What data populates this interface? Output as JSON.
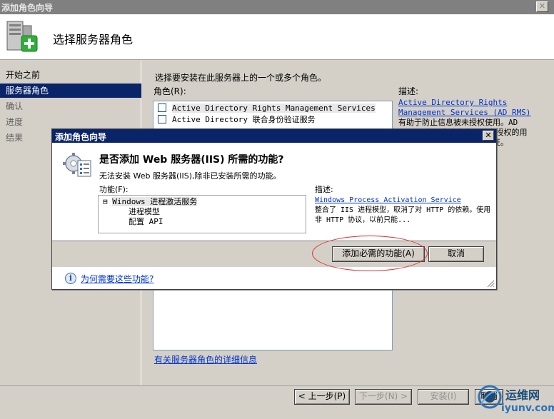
{
  "window": {
    "title": "添加角色向导",
    "close_glyph": "✕"
  },
  "header": {
    "title": "选择服务器角色"
  },
  "nav": {
    "items": [
      {
        "label": "开始之前"
      },
      {
        "label": "服务器角色"
      },
      {
        "label": "确认"
      },
      {
        "label": "进度"
      },
      {
        "label": "结果"
      }
    ]
  },
  "main": {
    "instruction": "选择要安装在此服务器上的一个或多个角色。",
    "roles_label": "角色(R):",
    "roles": [
      {
        "label": "Active Directory Rights Management Services"
      },
      {
        "label": "Active Directory 联合身份验证服务"
      }
    ],
    "description_label": "描述:",
    "description_link": "Active Directory Rights Management Services (AD RMS)",
    "description_text": "有助于防止信息被未授权使用。AD RMS 可为用户建立身份并为授权的用户提供对受保护信息的许可证。",
    "more_info_link": "有关服务器角色的详细信息"
  },
  "wizard_buttons": {
    "back": "< 上一步(P)",
    "next": "下一步(N) >",
    "install": "安装(I)",
    "cancel": "取消"
  },
  "dialog": {
    "title": "添加角色向导",
    "close_glyph": "✕",
    "question": "是否添加 Web 服务器(IIS) 所需的功能?",
    "subtext": "无法安装 Web 服务器(IIS),除非已安装所需的功能。",
    "features_label": "功能(F):",
    "features": {
      "root": "Windows 进程激活服务",
      "expander": "⊟",
      "children": [
        "进程模型",
        "配置 API"
      ]
    },
    "description_label": "描述:",
    "description_link": "Windows Process Activation Service",
    "description_text": "整合了 IIS 进程模型，取消了对 HTTP 的依赖。使用非 HTTP 协议，以前只能...",
    "add_button": "添加必需的功能(A)",
    "cancel_button": "取消",
    "help_glyph": "i",
    "help_link": "为何需要这些功能?"
  },
  "watermark": {
    "cn": "运维网",
    "url": "iyunv.com"
  },
  "colors": {
    "selection": "#0a246a",
    "link": "#0033cc",
    "annotation": "#e03030"
  }
}
